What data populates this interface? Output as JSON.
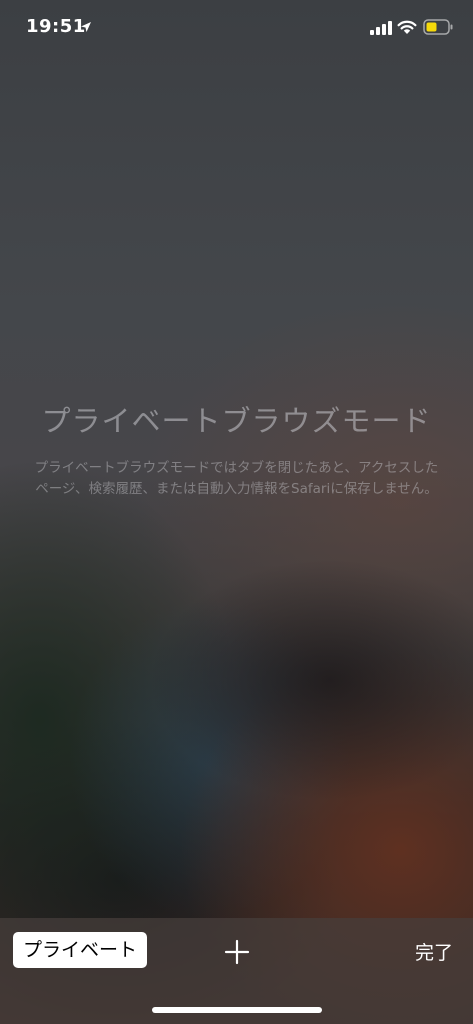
{
  "status_bar": {
    "time": "19:51"
  },
  "private_mode": {
    "title": "プライベートブラウズモード",
    "description": "プライベートブラウズモードではタブを閉じたあと、アクセスしたページ、検索履歴、または自動入力情報をSafariに保存しません。"
  },
  "toolbar": {
    "private_label": "プライベート",
    "done_label": "完了"
  },
  "icons": {
    "location": "location-arrow-icon",
    "signal": "cellular-signal-icon",
    "wifi": "wifi-icon",
    "battery": "battery-icon",
    "new_tab": "plus-icon"
  },
  "colors": {
    "battery_level": "#f5d90a"
  }
}
